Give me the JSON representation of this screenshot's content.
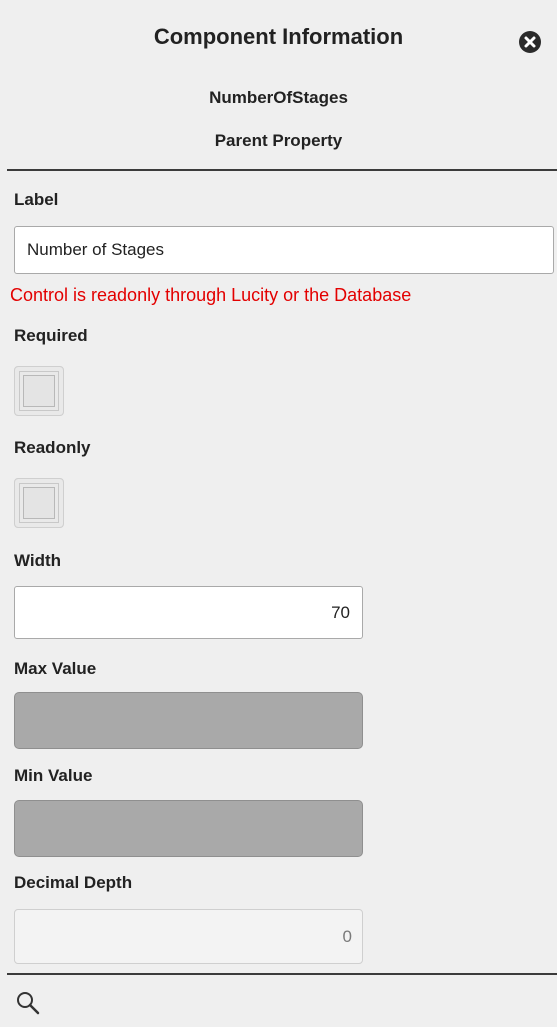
{
  "header": {
    "title": "Component Information",
    "component_name": "NumberOfStages",
    "component_type": "Parent Property",
    "close_icon": "close-circle-icon"
  },
  "fields": {
    "label": {
      "label": "Label",
      "value": "Number of Stages",
      "error": "Control is readonly through Lucity or the Database"
    },
    "required": {
      "label": "Required",
      "checked": false
    },
    "readonly": {
      "label": "Readonly",
      "checked": false
    },
    "width": {
      "label": "Width",
      "value": "70"
    },
    "max_value": {
      "label": "Max Value",
      "value": ""
    },
    "min_value": {
      "label": "Min Value",
      "value": ""
    },
    "decimal_depth": {
      "label": "Decimal Depth",
      "value": "0"
    }
  },
  "footer": {
    "search_icon": "search-icon"
  },
  "colors": {
    "background": "#efefef",
    "error": "#e30000",
    "disabled_field": "#a9a9a9",
    "divider": "#3b3b3b"
  }
}
